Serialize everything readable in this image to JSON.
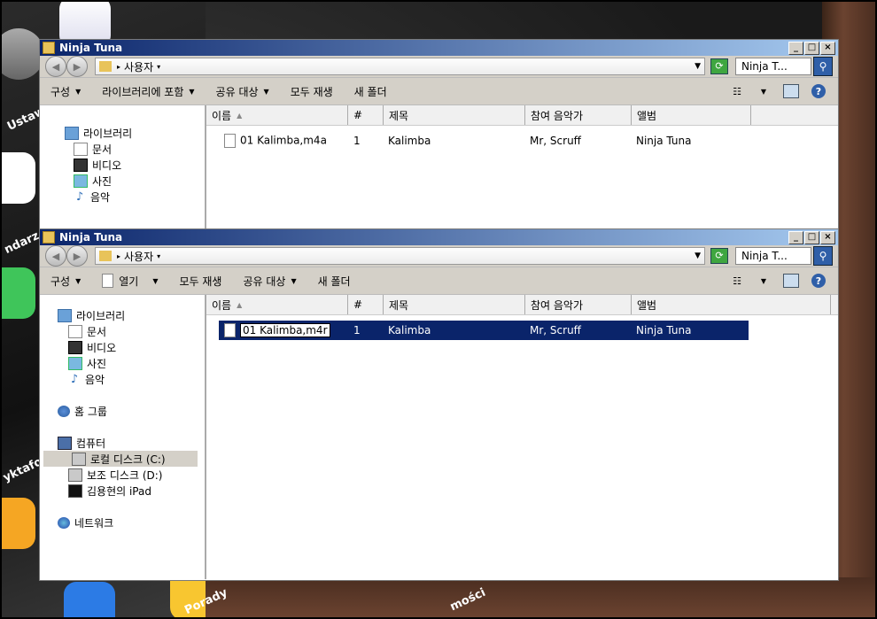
{
  "background": {
    "label_1": "Ustaw",
    "label_2": "ndarz",
    "label_3": "yktafor",
    "label_4": "Porady",
    "label_5": "mości"
  },
  "window1": {
    "title": "Ninja Tuna",
    "address": "사용자",
    "search_value": "Ninja T...",
    "toolbar": [
      "구성",
      "라이브러리에 포함",
      "공유 대상",
      "모두 재생",
      "새 폴더"
    ],
    "nav": {
      "library": "라이브러리",
      "docs": "문서",
      "videos": "비디오",
      "pictures": "사진",
      "music": "음악"
    },
    "columns": {
      "name": "이름",
      "num": "#",
      "title": "제목",
      "artist": "참여 음악가",
      "album": "앨범"
    },
    "file": {
      "name": "01 Kalimba,m4a",
      "num": "1",
      "title": "Kalimba",
      "artist": "Mr, Scruff",
      "album": "Ninja Tuna"
    }
  },
  "window2": {
    "title": "Ninja Tuna",
    "address": "사용자",
    "search_value": "Ninja T...",
    "toolbar": [
      "구성",
      "열기",
      "모두 재생",
      "공유 대상",
      "새 폴더"
    ],
    "nav": {
      "library": "라이브러리",
      "docs": "문서",
      "videos": "비디오",
      "pictures": "사진",
      "music": "음악",
      "homegroup": "홈 그룹",
      "computer": "컴퓨터",
      "local_disk": "로컬 디스크 (C:)",
      "aux_disk": "보조 디스크 (D:)",
      "ipad": "김용현의 iPad",
      "network": "네트워크"
    },
    "columns": {
      "name": "이름",
      "num": "#",
      "title": "제목",
      "artist": "참여 음악가",
      "album": "앨범"
    },
    "file": {
      "name": "01 Kalimba,m4r",
      "num": "1",
      "title": "Kalimba",
      "artist": "Mr, Scruff",
      "album": "Ninja Tuna"
    }
  },
  "colors": {
    "titlebar_start": "#0a246a",
    "titlebar_end": "#a6caf0",
    "selection": "#0a246a",
    "chrome": "#d4d0c8"
  }
}
